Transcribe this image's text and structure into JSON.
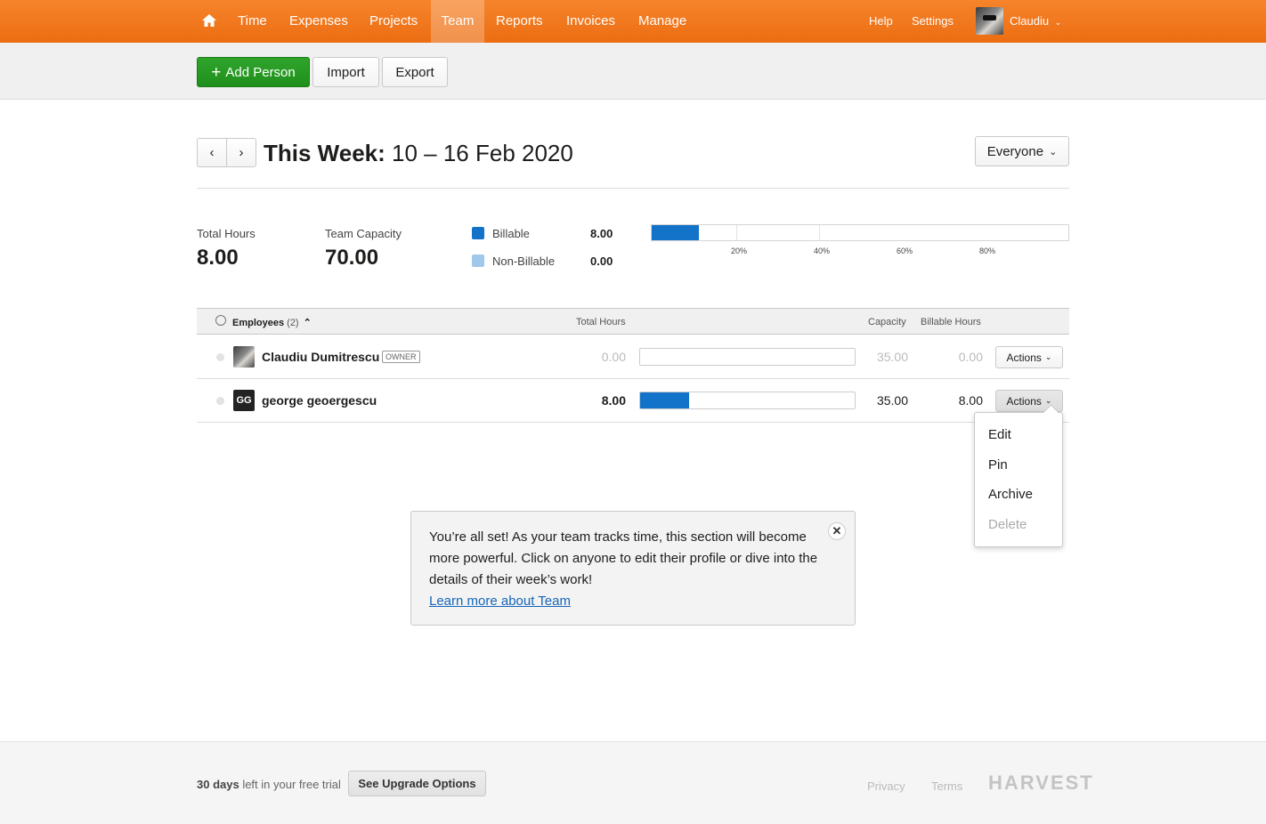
{
  "nav": {
    "home_icon": "home-icon",
    "items": [
      {
        "label": "Time"
      },
      {
        "label": "Expenses"
      },
      {
        "label": "Projects"
      },
      {
        "label": "Team",
        "active": true
      },
      {
        "label": "Reports"
      },
      {
        "label": "Invoices"
      },
      {
        "label": "Manage"
      }
    ],
    "help": "Help",
    "settings": "Settings",
    "user": "Claudiu",
    "accent": "#f47c20"
  },
  "toolbar": {
    "add_person": "Add Person",
    "import": "Import",
    "export": "Export"
  },
  "week": {
    "label": "This Week:",
    "range": "10 – 16 Feb 2020",
    "filter": "Everyone"
  },
  "stats": {
    "total_hours_label": "Total Hours",
    "total_hours": "8.00",
    "capacity_label": "Team Capacity",
    "capacity": "70.00",
    "billable_label": "Billable",
    "billable": "8.00",
    "nonbillable_label": "Non-Billable",
    "nonbillable": "0.00",
    "billable_color": "#1273c8",
    "nonbillable_color": "#a0c8ea",
    "utilization_fraction": 0.114,
    "ticks": [
      "20%",
      "40%",
      "60%",
      "80%"
    ]
  },
  "table": {
    "employees_label": "Employees",
    "employees_count": "(2)",
    "col_total": "Total Hours",
    "col_capacity": "Capacity",
    "col_billable": "Billable Hours",
    "rows": [
      {
        "name": "Claudiu Dumitrescu",
        "badge": "OWNER",
        "total": "0.00",
        "capacity": "35.00",
        "billable": "0.00",
        "actions": "Actions",
        "fraction": 0
      },
      {
        "name": "george geoergescu",
        "initials": "GG",
        "total": "8.00",
        "capacity": "35.00",
        "billable": "8.00",
        "actions": "Actions",
        "fraction": 0.229
      }
    ]
  },
  "actions_menu": {
    "items": [
      "Edit",
      "Pin",
      "Archive",
      "Delete"
    ]
  },
  "notice": {
    "text": "You’re all set! As your team tracks time, this section will become more powerful. Click on anyone to edit their profile or dive into the details of their week’s work!",
    "link": "Learn more about Team"
  },
  "footer": {
    "trial_days": "30 days",
    "trial_rest": " left in your free trial",
    "upgrade": "See Upgrade Options",
    "privacy": "Privacy",
    "terms": "Terms",
    "logo": "HARVEST"
  }
}
